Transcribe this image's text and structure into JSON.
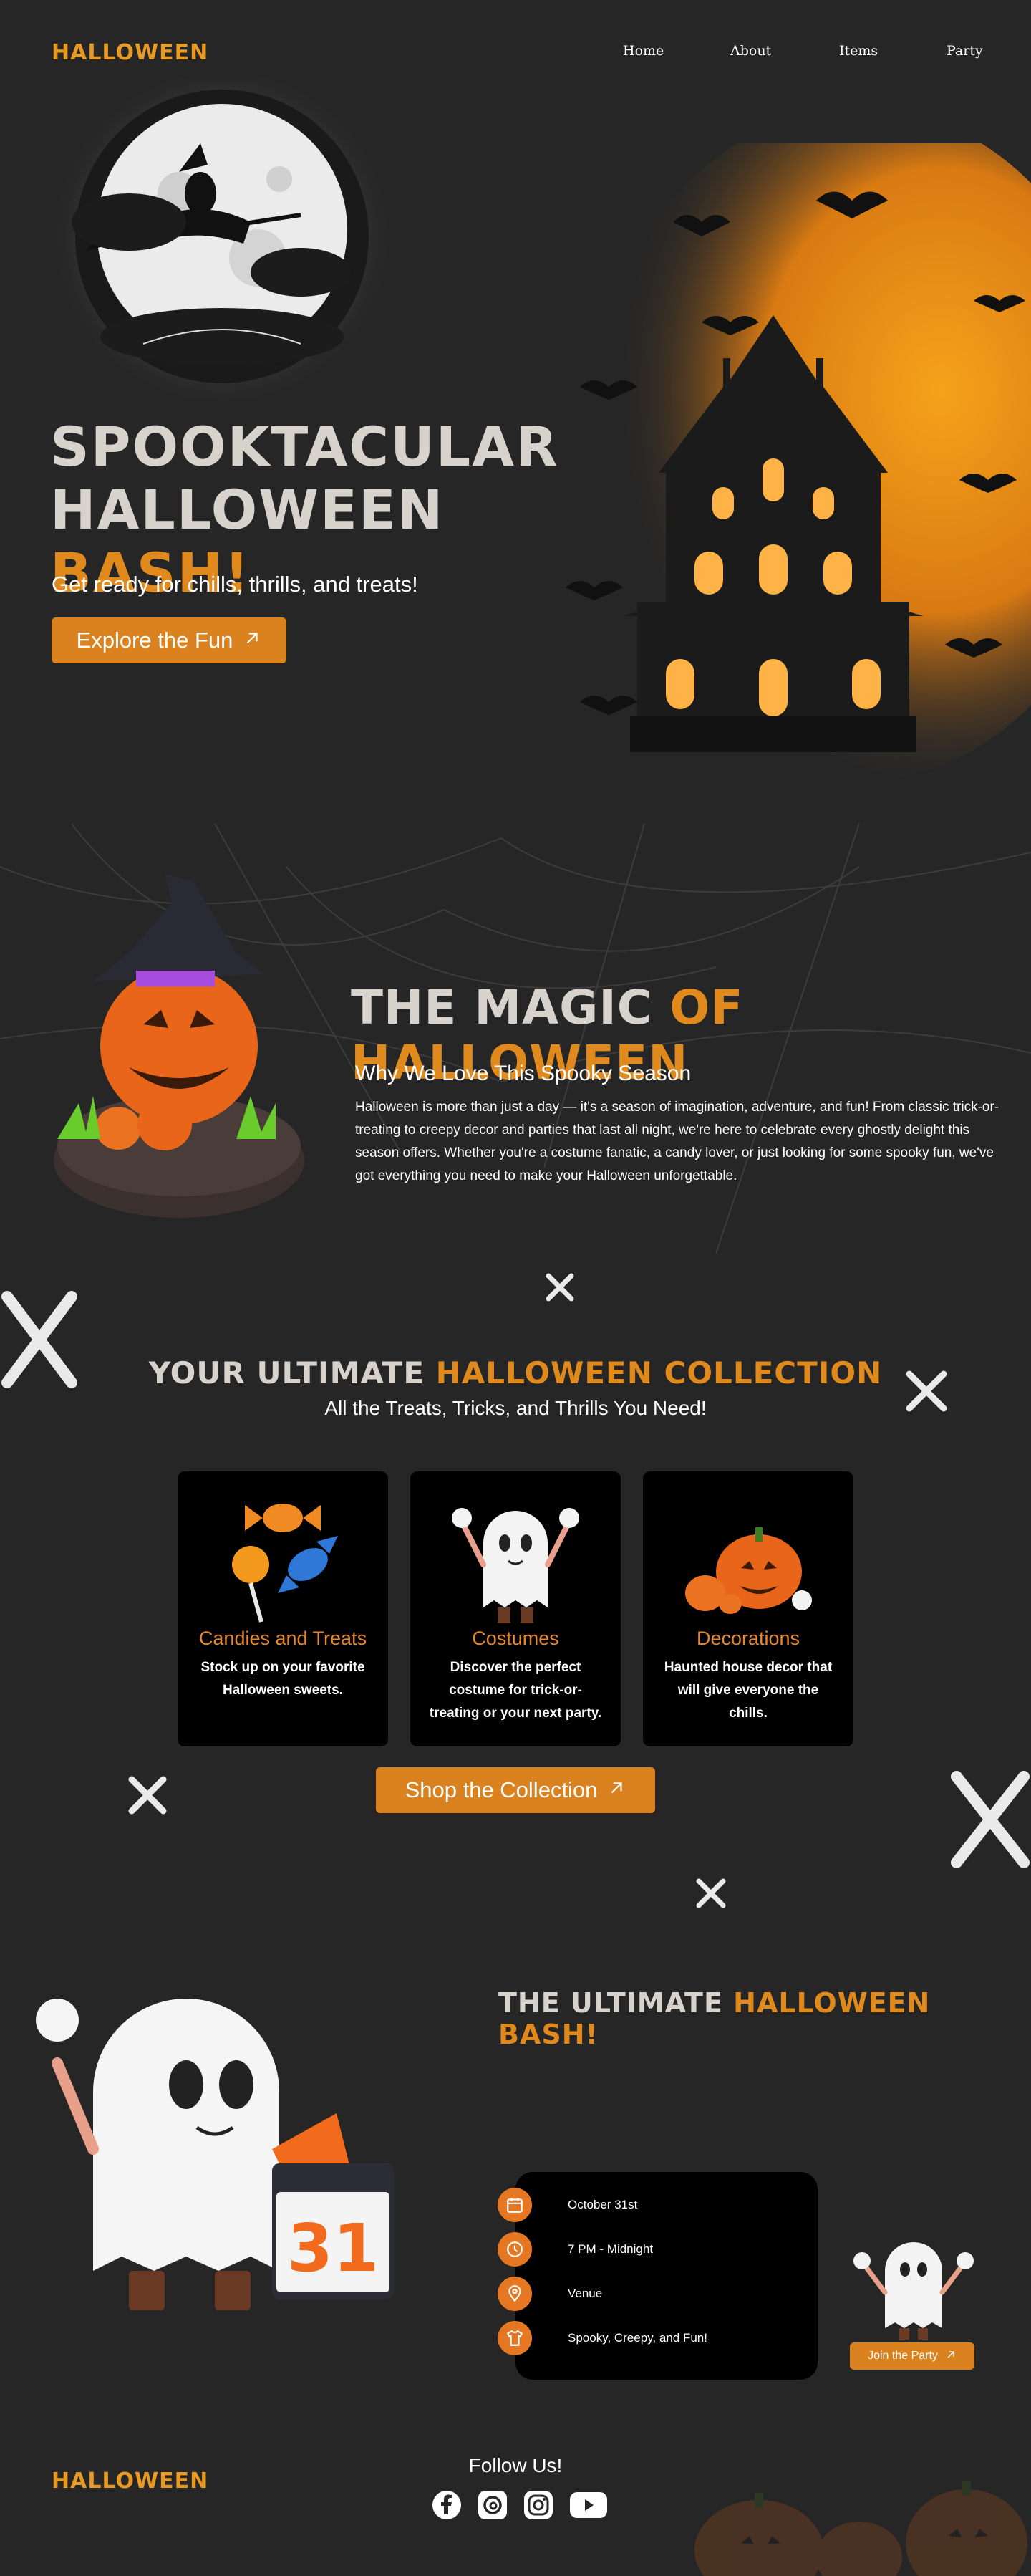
{
  "colors": {
    "background": "#262626",
    "accent": "#e08a1e",
    "button": "#d9821f",
    "card": "#000000"
  },
  "header": {
    "logo": "HALLOWEEN",
    "nav": [
      "Home",
      "About",
      "Items",
      "Party"
    ]
  },
  "hero": {
    "title_line1": "SPOOKTACULAR",
    "title_line2_a": "HALLOWEEN",
    "title_line2_b": "BASH!",
    "subtitle": "Get ready for chills, thrills, and treats!",
    "cta": "Explore the Fun"
  },
  "magic": {
    "title_a": "THE MAGIC",
    "title_b": "OF HALLOWEEN",
    "subtitle": "Why We Love This Spooky Season",
    "body": "Halloween is more than just a day — it's a season of imagination, adventure, and fun! From classic trick-or-treating to creepy decor and parties that last all night, we're here to celebrate every ghostly delight this season offers. Whether you're a costume fanatic, a candy lover, or just looking for some spooky fun, we've got everything you need to make your Halloween unforgettable."
  },
  "collection": {
    "title_a": "YOUR ULTIMATE",
    "title_b": "HALLOWEEN COLLECTION",
    "subtitle": "All the Treats, Tricks, and Thrills You Need!",
    "cards": [
      {
        "title": "Candies and Treats",
        "desc": "Stock up on your favorite Halloween sweets."
      },
      {
        "title": "Costumes",
        "desc": "Discover the perfect costume for trick-or-treating or your next party."
      },
      {
        "title": "Decorations",
        "desc": "Haunted house decor that will give everyone the chills."
      }
    ],
    "cta": "Shop the Collection"
  },
  "party": {
    "title_a": "THE ULTIMATE",
    "title_b": "HALLOWEEN BASH!",
    "details": [
      {
        "icon": "calendar-icon",
        "text": "October 31st"
      },
      {
        "icon": "clock-icon",
        "text": "7 PM - Midnight"
      },
      {
        "icon": "location-icon",
        "text": "Venue"
      },
      {
        "icon": "shirt-icon",
        "text": "Spooky, Creepy, and Fun!"
      }
    ],
    "calendar_number": "31",
    "cta": "Join the Party"
  },
  "footer": {
    "logo": "HALLOWEEN",
    "follow": "Follow Us!",
    "socials": [
      "facebook-icon",
      "threads-icon",
      "instagram-icon",
      "youtube-icon"
    ]
  }
}
